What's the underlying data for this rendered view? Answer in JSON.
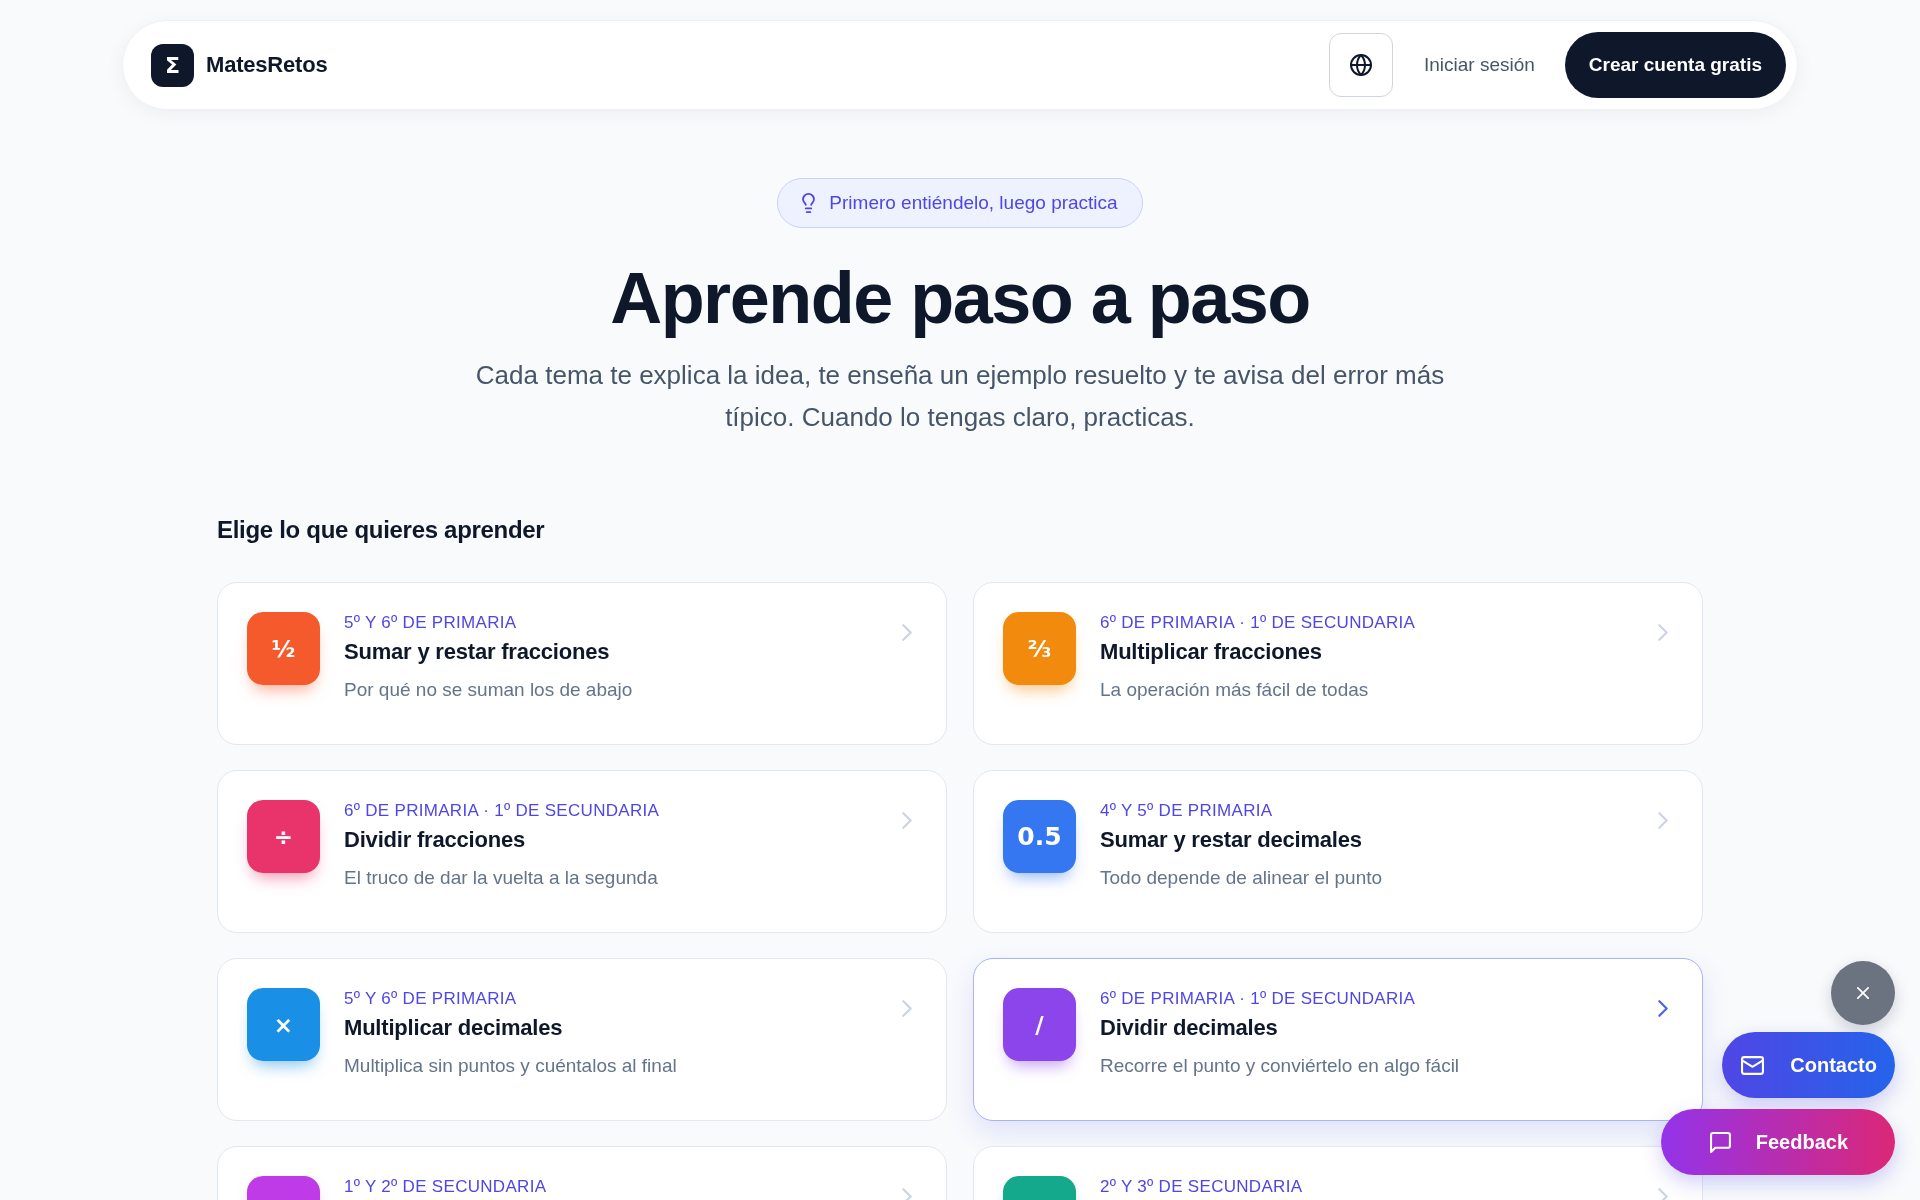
{
  "header": {
    "logo_symbol": "Σ",
    "brand": "MatesRetos",
    "login": "Iniciar sesión",
    "signup": "Crear cuenta gratis"
  },
  "hero": {
    "badge": "Primero entiéndelo, luego practica",
    "title": "Aprende paso a paso",
    "subtitle": "Cada tema te explica la idea, te enseña un ejemplo resuelto y te avisa del error más típico. Cuando lo tengas claro, practicas."
  },
  "section_title": "Elige lo que quieres aprender",
  "topics": [
    {
      "symbol": "½",
      "color": "#f55a2c",
      "grade": "5º Y 6º DE PRIMARIA",
      "title": "Sumar y restar fracciones",
      "description": "Por qué no se suman los de abajo",
      "highlighted": false
    },
    {
      "symbol": "⅔",
      "color": "#f28a0e",
      "grade": "6º DE PRIMARIA · 1º DE SECUNDARIA",
      "title": "Multiplicar fracciones",
      "description": "La operación más fácil de todas",
      "highlighted": false
    },
    {
      "symbol": "÷",
      "color": "#e8336b",
      "grade": "6º DE PRIMARIA · 1º DE SECUNDARIA",
      "title": "Dividir fracciones",
      "description": "El truco de dar la vuelta a la segunda",
      "highlighted": false
    },
    {
      "symbol": "0.5",
      "color": "#3577f0",
      "grade": "4º Y 5º DE PRIMARIA",
      "title": "Sumar y restar decimales",
      "description": "Todo depende de alinear el punto",
      "highlighted": false
    },
    {
      "symbol": "×",
      "color": "#1a8fe6",
      "grade": "5º Y 6º DE PRIMARIA",
      "title": "Multiplicar decimales",
      "description": "Multiplica sin puntos y cuéntalos al final",
      "highlighted": false
    },
    {
      "symbol": "/",
      "color": "#8b45eb",
      "grade": "6º DE PRIMARIA · 1º DE SECUNDARIA",
      "title": "Dividir decimales",
      "description": "Recorre el punto y conviértelo en algo fácil",
      "highlighted": true
    },
    {
      "color": "#c03be8",
      "grade": "1º Y 2º DE SECUNDARIA",
      "highlighted": false
    },
    {
      "color": "#14a88c",
      "grade": "2º Y 3º DE SECUNDARIA",
      "highlighted": false
    }
  ],
  "floating_buttons": [
    {
      "kind": "contact",
      "label": "Contacto"
    },
    {
      "kind": "feedback",
      "label": "Feedback"
    }
  ]
}
